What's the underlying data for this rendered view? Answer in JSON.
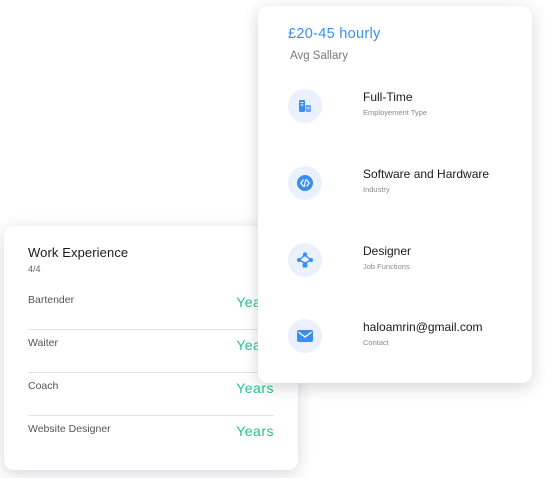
{
  "work_experience": {
    "title": "Work Experience",
    "count": "4/4",
    "items": [
      {
        "role": "Bartender",
        "duration": "Years"
      },
      {
        "role": "Waiter",
        "duration": "Years"
      },
      {
        "role": "Coach",
        "duration": "Years"
      },
      {
        "role": "Website Designer",
        "duration": "Years"
      }
    ]
  },
  "job_info": {
    "salary": "£20-45 hourly",
    "salary_label": "Avg Sallary",
    "items": [
      {
        "icon": "building-icon",
        "title": "Full-Time",
        "subtitle": "Employement Type"
      },
      {
        "icon": "code-icon",
        "title": "Software and Hardware",
        "subtitle": "Industry"
      },
      {
        "icon": "network-icon",
        "title": "Designer",
        "subtitle": "Job Functions"
      },
      {
        "icon": "mail-icon",
        "title": "haloamrin@gmail.com",
        "subtitle": "Contact"
      }
    ]
  },
  "colors": {
    "accent_blue": "#3a8ef0",
    "icon_bg": "#eaf1fc",
    "accent_green": "#26c08f"
  }
}
